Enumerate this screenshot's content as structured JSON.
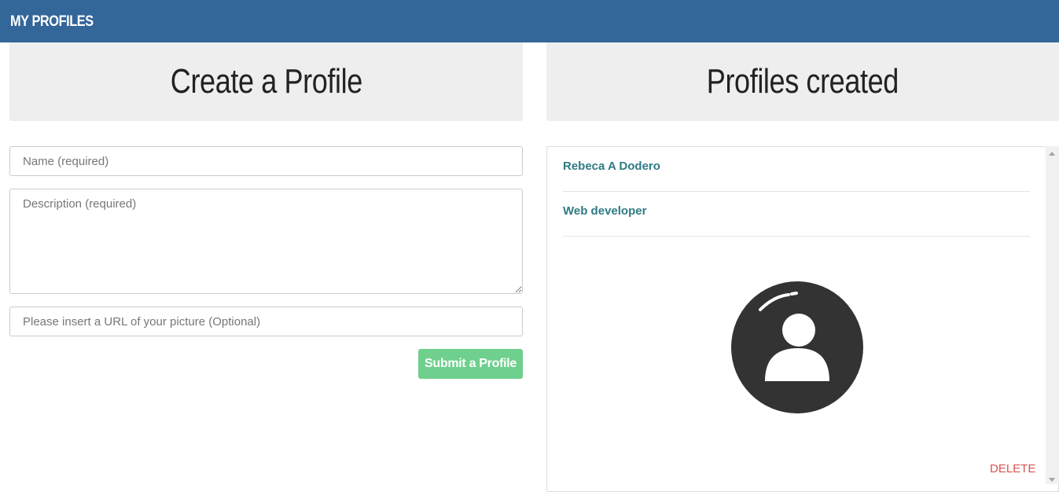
{
  "navbar": {
    "brand": "MY PROFILES"
  },
  "left_panel": {
    "title": "Create a Profile",
    "name_placeholder": "Name (required)",
    "description_placeholder": "Description (required)",
    "url_placeholder": "Please insert a URL of your picture (Optional)",
    "submit_label": "Submit a Profile"
  },
  "right_panel": {
    "title": "Profiles created",
    "profiles": [
      {
        "name": "Rebeca A Dodero",
        "description": "Web developer",
        "avatar_icon": "user-avatar-icon",
        "delete_label": "DELETE"
      }
    ]
  },
  "colors": {
    "navbar": "#336699",
    "panel_heading": "#eeeeee",
    "submit_button": "#6fcf8d",
    "profile_text": "#2f7b84",
    "delete_text": "#d9534f",
    "avatar": "#333333"
  }
}
